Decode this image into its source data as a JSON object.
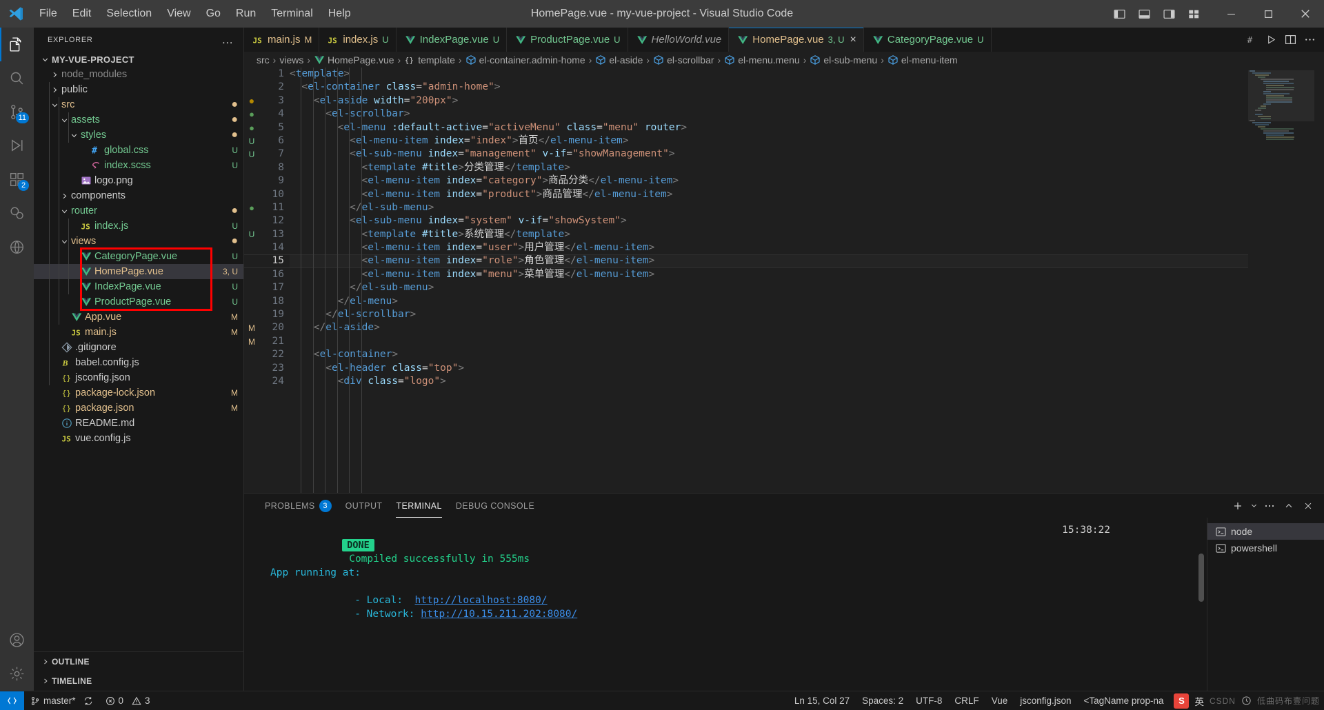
{
  "titlebar": {
    "window_title": "HomePage.vue - my-vue-project - Visual Studio Code",
    "menus": [
      "File",
      "Edit",
      "Selection",
      "View",
      "Go",
      "Run",
      "Terminal",
      "Help"
    ],
    "layout_icons": [
      "toggle-primary-sidebar-icon",
      "toggle-panel-icon",
      "toggle-secondary-sidebar-icon",
      "customize-layout-icon"
    ],
    "window_controls": [
      "minimize",
      "maximize",
      "close"
    ]
  },
  "activitybar": {
    "items": [
      {
        "name": "explorer",
        "icon": "files-icon",
        "badge": ""
      },
      {
        "name": "search",
        "icon": "search-icon",
        "badge": ""
      },
      {
        "name": "source-control",
        "icon": "source-control-icon",
        "badge": "11"
      },
      {
        "name": "run-and-debug",
        "icon": "debug-icon",
        "badge": ""
      },
      {
        "name": "extensions",
        "icon": "extensions-icon",
        "badge": "2"
      },
      {
        "name": "testing",
        "icon": "beaker-icon",
        "badge": ""
      },
      {
        "name": "remote-explorer",
        "icon": "remote-icon",
        "badge": ""
      }
    ],
    "bottom": [
      {
        "name": "accounts",
        "icon": "account-icon"
      },
      {
        "name": "settings",
        "icon": "gear-icon"
      }
    ]
  },
  "sidebar": {
    "title": "EXPLORER",
    "more_actions": "…",
    "root": "MY-VUE-PROJECT",
    "tree": [
      {
        "label": "node_modules",
        "type": "folder",
        "state": "collapsed",
        "indent": 1,
        "color": "dim",
        "deco": ""
      },
      {
        "label": "public",
        "type": "folder",
        "state": "collapsed",
        "indent": 1,
        "color": "grey",
        "deco": ""
      },
      {
        "label": "src",
        "type": "folder",
        "state": "expanded",
        "indent": 1,
        "color": "orange",
        "deco": "dot"
      },
      {
        "label": "assets",
        "type": "folder",
        "state": "expanded",
        "indent": 2,
        "color": "green",
        "deco": "dot"
      },
      {
        "label": "styles",
        "type": "folder",
        "state": "expanded",
        "indent": 3,
        "color": "green",
        "deco": "dot"
      },
      {
        "label": "global.css",
        "type": "css",
        "state": "file",
        "indent": 4,
        "color": "green",
        "deco": "U"
      },
      {
        "label": "index.scss",
        "type": "scss",
        "state": "file",
        "indent": 4,
        "color": "green",
        "deco": "U"
      },
      {
        "label": "logo.png",
        "type": "image",
        "state": "file",
        "indent": 3,
        "color": "grey",
        "deco": ""
      },
      {
        "label": "components",
        "type": "folder",
        "state": "collapsed",
        "indent": 2,
        "color": "grey",
        "deco": ""
      },
      {
        "label": "router",
        "type": "folder",
        "state": "expanded",
        "indent": 2,
        "color": "green",
        "deco": "dot"
      },
      {
        "label": "index.js",
        "type": "js",
        "state": "file",
        "indent": 3,
        "color": "green",
        "deco": "U"
      },
      {
        "label": "views",
        "type": "folder",
        "state": "expanded",
        "indent": 2,
        "color": "orange",
        "deco": "dot"
      },
      {
        "label": "CategoryPage.vue",
        "type": "vue",
        "state": "file",
        "indent": 3,
        "color": "green",
        "deco": "U"
      },
      {
        "label": "HomePage.vue",
        "type": "vue",
        "state": "file",
        "indent": 3,
        "color": "orange",
        "deco": "3, U",
        "selected": true
      },
      {
        "label": "IndexPage.vue",
        "type": "vue",
        "state": "file",
        "indent": 3,
        "color": "green",
        "deco": "U"
      },
      {
        "label": "ProductPage.vue",
        "type": "vue",
        "state": "file",
        "indent": 3,
        "color": "green",
        "deco": "U"
      },
      {
        "label": "App.vue",
        "type": "vue",
        "state": "file",
        "indent": 2,
        "color": "orange",
        "deco": "M"
      },
      {
        "label": "main.js",
        "type": "js",
        "state": "file",
        "indent": 2,
        "color": "orange",
        "deco": "M"
      },
      {
        "label": ".gitignore",
        "type": "git",
        "state": "file",
        "indent": 1,
        "color": "grey",
        "deco": ""
      },
      {
        "label": "babel.config.js",
        "type": "babel",
        "state": "file",
        "indent": 1,
        "color": "grey",
        "deco": ""
      },
      {
        "label": "jsconfig.json",
        "type": "json",
        "state": "file",
        "indent": 1,
        "color": "grey",
        "deco": ""
      },
      {
        "label": "package-lock.json",
        "type": "json",
        "state": "file",
        "indent": 1,
        "color": "orange",
        "deco": "M"
      },
      {
        "label": "package.json",
        "type": "json",
        "state": "file",
        "indent": 1,
        "color": "orange",
        "deco": "M"
      },
      {
        "label": "README.md",
        "type": "md",
        "state": "file",
        "indent": 1,
        "color": "grey",
        "deco": ""
      },
      {
        "label": "vue.config.js",
        "type": "js",
        "state": "file",
        "indent": 1,
        "color": "grey",
        "deco": ""
      }
    ],
    "sections": [
      "OUTLINE",
      "TIMELINE"
    ],
    "highlight_color": "#ff0000"
  },
  "tabs": [
    {
      "label": "main.js",
      "icon": "js-icon",
      "deco": "M",
      "deco_kind": "M",
      "style": "js",
      "active": false
    },
    {
      "label": "index.js",
      "icon": "js-icon",
      "deco": "U",
      "deco_kind": "U",
      "style": "js",
      "active": false
    },
    {
      "label": "IndexPage.vue",
      "icon": "vue-icon",
      "deco": "U",
      "deco_kind": "U",
      "style": "vue",
      "active": false
    },
    {
      "label": "ProductPage.vue",
      "icon": "vue-icon",
      "deco": "U",
      "deco_kind": "U",
      "style": "vue",
      "active": false
    },
    {
      "label": "HelloWorld.vue",
      "icon": "vue-icon",
      "deco": "",
      "deco_kind": "",
      "style": "preview",
      "active": false
    },
    {
      "label": "HomePage.vue",
      "icon": "vue-icon",
      "deco": "3, U",
      "deco_kind": "U",
      "style": "vue",
      "active": true,
      "close": "×"
    },
    {
      "label": "CategoryPage.vue",
      "icon": "vue-icon",
      "deco": "U",
      "deco_kind": "U",
      "style": "vue",
      "active": false
    }
  ],
  "tab_actions": [
    "markdown-preview-icon",
    "run-icon",
    "split-vertical-icon",
    "more-actions-icon"
  ],
  "breadcrumb": [
    {
      "label": "src",
      "icon": ""
    },
    {
      "label": "views",
      "icon": ""
    },
    {
      "label": "HomePage.vue",
      "icon": "vue-icon"
    },
    {
      "label": "template",
      "icon": "braces-icon"
    },
    {
      "label": "el-container.admin-home",
      "icon": "cube-icon"
    },
    {
      "label": "el-aside",
      "icon": "cube-icon"
    },
    {
      "label": "el-scrollbar",
      "icon": "cube-icon"
    },
    {
      "label": "el-menu.menu",
      "icon": "cube-icon"
    },
    {
      "label": "el-sub-menu",
      "icon": "cube-icon"
    },
    {
      "label": "el-menu-item",
      "icon": "cube-icon"
    }
  ],
  "editor": {
    "first_line": 1,
    "current_line": 15,
    "gutter_decos": [
      "",
      "",
      "dot-orange",
      "dot-green",
      "dot-green",
      "U",
      "U",
      "",
      "",
      "",
      "dot-green",
      "",
      "U",
      "",
      "",
      "",
      "",
      "",
      "",
      "M",
      "M",
      "",
      "",
      ""
    ],
    "lines": [
      {
        "n": 1,
        "indent": 0,
        "text": "<template>"
      },
      {
        "n": 2,
        "indent": 1,
        "text": "<el-container class=\"admin-home\">"
      },
      {
        "n": 3,
        "indent": 2,
        "text": "<el-aside width=\"200px\">"
      },
      {
        "n": 4,
        "indent": 3,
        "text": "<el-scrollbar>"
      },
      {
        "n": 5,
        "indent": 4,
        "text": "<el-menu :default-active=\"activeMenu\" class=\"menu\" router>"
      },
      {
        "n": 6,
        "indent": 5,
        "text": "<el-menu-item index=\"index\">首页</el-menu-item>"
      },
      {
        "n": 7,
        "indent": 5,
        "text": "<el-sub-menu index=\"management\" v-if=\"showManagement\">"
      },
      {
        "n": 8,
        "indent": 6,
        "text": "<template #title>分类管理</template>"
      },
      {
        "n": 9,
        "indent": 6,
        "text": "<el-menu-item index=\"category\">商品分类</el-menu-item>"
      },
      {
        "n": 10,
        "indent": 6,
        "text": "<el-menu-item index=\"product\">商品管理</el-menu-item>"
      },
      {
        "n": 11,
        "indent": 5,
        "text": "</el-sub-menu>"
      },
      {
        "n": 12,
        "indent": 5,
        "text": "<el-sub-menu index=\"system\" v-if=\"showSystem\">"
      },
      {
        "n": 13,
        "indent": 6,
        "text": "<template #title>系统管理</template>"
      },
      {
        "n": 14,
        "indent": 6,
        "text": "<el-menu-item index=\"user\">用户管理</el-menu-item>"
      },
      {
        "n": 15,
        "indent": 6,
        "text": "<el-menu-item index=\"role\">角色管理</el-menu-item>"
      },
      {
        "n": 16,
        "indent": 6,
        "text": "<el-menu-item index=\"menu\">菜单管理</el-menu-item>"
      },
      {
        "n": 17,
        "indent": 5,
        "text": "</el-sub-menu>"
      },
      {
        "n": 18,
        "indent": 4,
        "text": "</el-menu>"
      },
      {
        "n": 19,
        "indent": 3,
        "text": "</el-scrollbar>"
      },
      {
        "n": 20,
        "indent": 2,
        "text": "</el-aside>"
      },
      {
        "n": 21,
        "indent": 0,
        "text": ""
      },
      {
        "n": 22,
        "indent": 2,
        "text": "<el-container>"
      },
      {
        "n": 23,
        "indent": 3,
        "text": "<el-header class=\"top\">"
      },
      {
        "n": 24,
        "indent": 4,
        "text": "<div class=\"logo\">"
      }
    ]
  },
  "panel": {
    "tabs": [
      {
        "label": "PROBLEMS",
        "badge": "3",
        "active": false
      },
      {
        "label": "OUTPUT",
        "badge": "",
        "active": false
      },
      {
        "label": "TERMINAL",
        "badge": "",
        "active": true
      },
      {
        "label": "DEBUG CONSOLE",
        "badge": "",
        "active": false
      }
    ],
    "actions": [
      "new-terminal-icon",
      "split-terminal-dropdown-icon",
      "more-actions-icon",
      "maximize-panel-icon",
      "close-panel-icon"
    ],
    "terminal": {
      "status_badge": "DONE",
      "status_text": "Compiled successfully in 555ms",
      "timestamp": "15:38:22",
      "app_running_label": "App running at:",
      "local_label": "- Local:",
      "local_url": "http://localhost:8080/",
      "network_label": "- Network:",
      "network_url": "http://10.15.211.202:8080/"
    },
    "terminal_list": [
      {
        "label": "node",
        "icon": "terminal-icon",
        "active": true
      },
      {
        "label": "powershell",
        "icon": "terminal-icon",
        "active": false
      }
    ]
  },
  "statusbar": {
    "remote_icon": "remote-window-icon",
    "branch": "master*",
    "sync_icon": "sync-icon",
    "errors": "0",
    "warnings": "3",
    "cursor": "Ln 15, Col 27",
    "spaces": "Spaces: 2",
    "encoding": "UTF-8",
    "eol": "CRLF",
    "language": "Vue",
    "config": "jsconfig.json",
    "tagname": "<TagName prop-na",
    "ime_label": "英",
    "ime_brand": "CSDN",
    "watermark": "低曲码布壹问题"
  },
  "colors": {
    "accent": "#0078d4",
    "vue_green": "#73c991",
    "modified_orange": "#e2c08d",
    "highlight_red": "#ff0000",
    "terminal_green": "#23d18b"
  }
}
